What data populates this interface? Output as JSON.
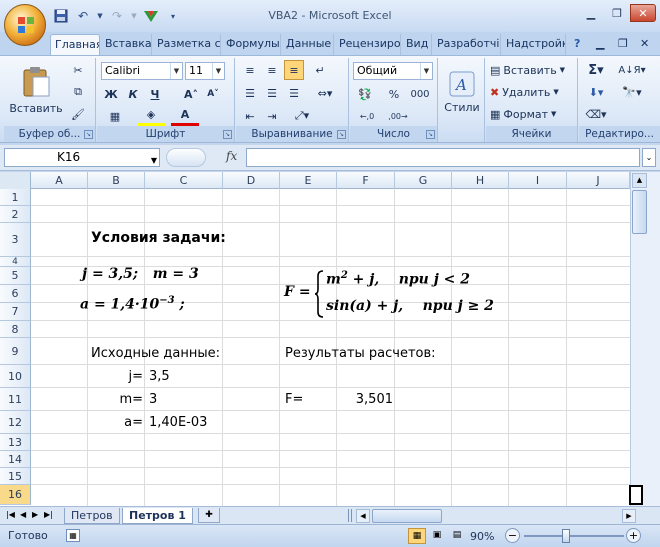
{
  "window": {
    "title": "VBA2 - Microsoft Excel"
  },
  "qat": {
    "icons": [
      "save-icon",
      "undo-icon",
      "redo-icon",
      "custom-icon",
      "customize-qat-icon"
    ]
  },
  "tabs": [
    {
      "label": "Главная",
      "active": true
    },
    {
      "label": "Вставка"
    },
    {
      "label": "Разметка с"
    },
    {
      "label": "Формулы"
    },
    {
      "label": "Данные"
    },
    {
      "label": "Рецензиро"
    },
    {
      "label": "Вид"
    },
    {
      "label": "Разработчі"
    },
    {
      "label": "Надстройк"
    }
  ],
  "ribbon": {
    "clipboard": {
      "label": "Буфер об...",
      "paste": "Вставить"
    },
    "font": {
      "label": "Шрифт",
      "name": "Calibri",
      "size": "11",
      "bold": "Ж",
      "italic": "К",
      "underline": "Ч"
    },
    "alignment": {
      "label": "Выравнивание"
    },
    "number": {
      "label": "Число",
      "format": "Общий",
      "percent": "%",
      "thousands": "000"
    },
    "styles": {
      "label": "Стили"
    },
    "cells": {
      "label": "Ячейки",
      "insert": "Вставить",
      "delete": "Удалить",
      "format": "Формат"
    },
    "editing": {
      "label": "Редактиро..."
    }
  },
  "formula_bar": {
    "name_box": "K16",
    "fx": "fx",
    "value": ""
  },
  "grid": {
    "columns": [
      "A",
      "B",
      "C",
      "D",
      "E",
      "F",
      "G",
      "H",
      "I",
      "J"
    ],
    "rows": [
      "1",
      "2",
      "3",
      "4",
      "5",
      "6",
      "7",
      "8",
      "9",
      "10",
      "11",
      "12",
      "13",
      "14",
      "15",
      "16"
    ],
    "cells": {
      "b3": "Условия задачи:",
      "b9": "Исходные данные:",
      "e9": "Результаты расчетов:",
      "b10": "j=",
      "c10": "3,5",
      "b11": "m=",
      "c11": "3",
      "b12": "a=",
      "c12": "1,40E-03",
      "e11": "F=",
      "f11": "3,501"
    },
    "formulas": {
      "line1": "j = 3,5;   m = 3",
      "line2_a": "a = 1,4·10",
      "line2_exp": "−3",
      "line2_end": ";",
      "f_lhs": "F =",
      "case1": "m",
      "case1_exp": "2",
      "case1_rest": " + j,    при j < 2",
      "case2": "sin(a) + j,    при j ≥ 2"
    }
  },
  "sheets": [
    {
      "name": "Петров",
      "active": false
    },
    {
      "name": "Петров 1",
      "active": true
    }
  ],
  "status": {
    "text": "Готово",
    "zoom": "90%",
    "minus": "−",
    "plus": "+"
  }
}
